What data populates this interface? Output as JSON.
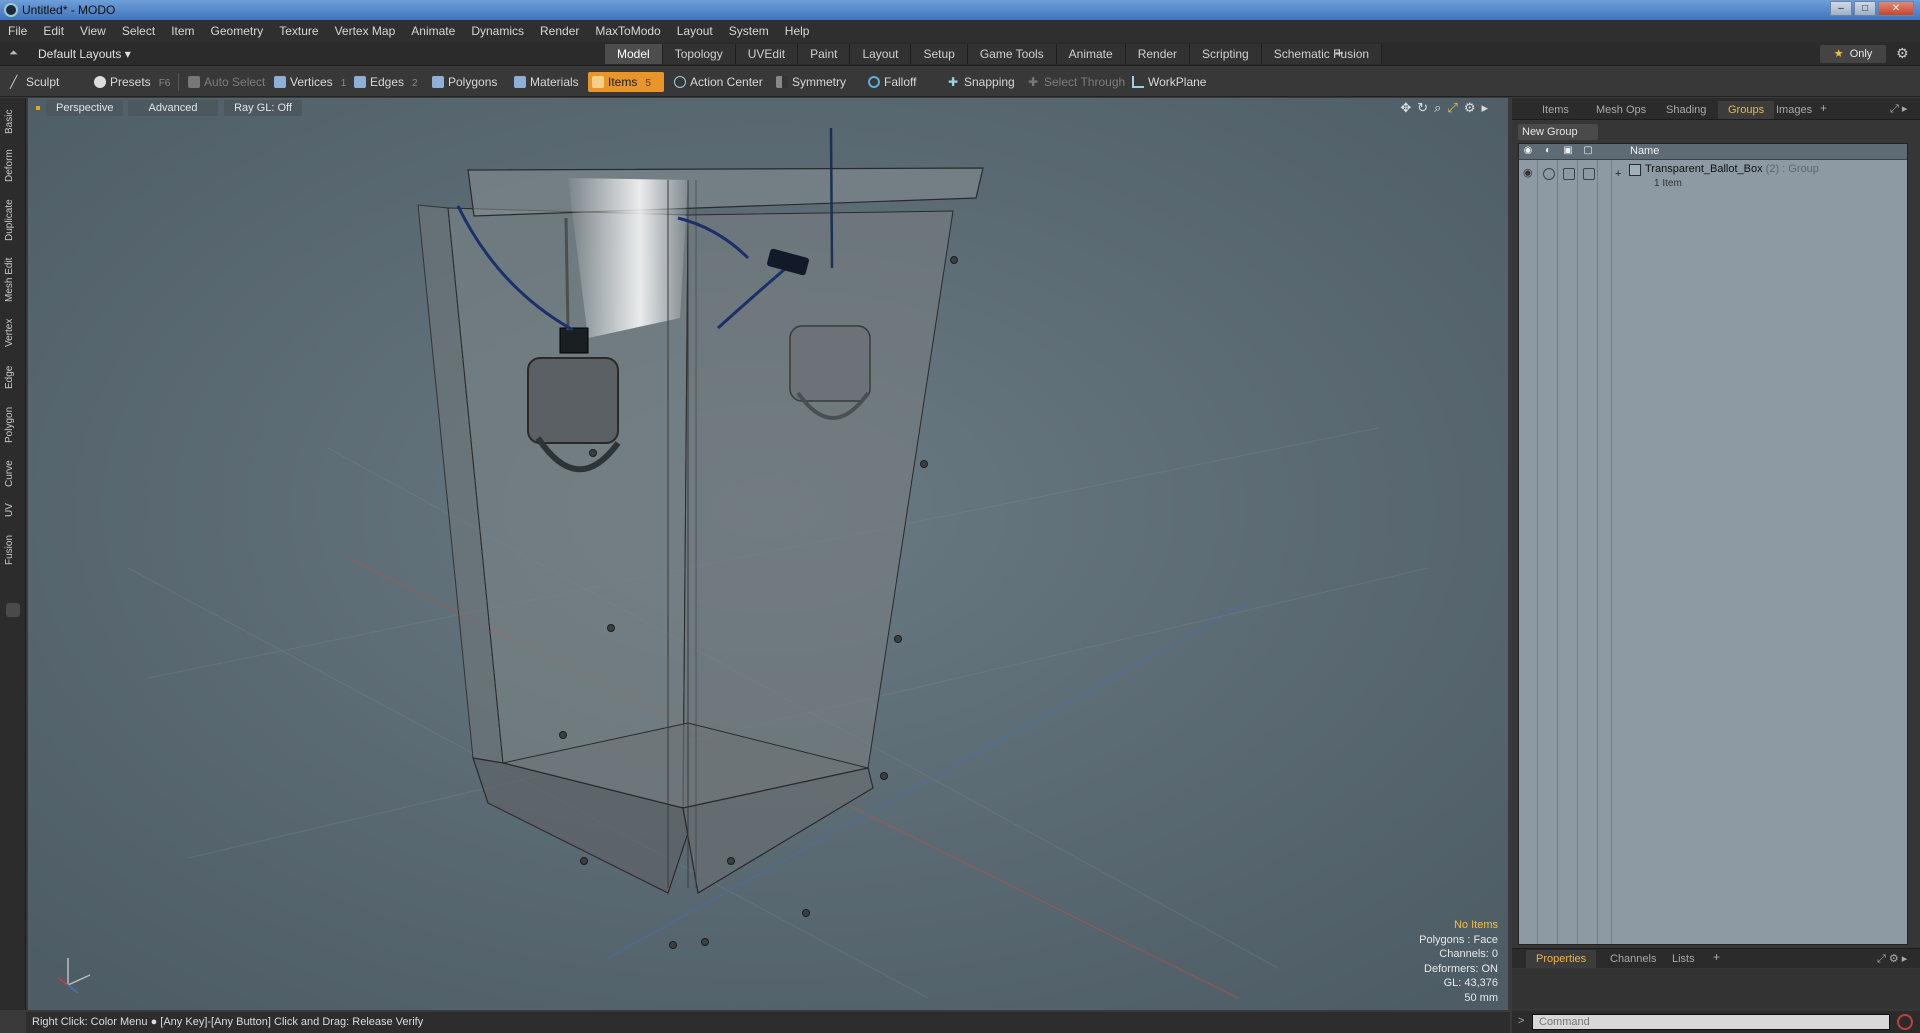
{
  "window": {
    "title": "Untitled* - MODO",
    "controls": {
      "minimize": "–",
      "maximize": "□",
      "close": "✕"
    }
  },
  "menubar": [
    "File",
    "Edit",
    "View",
    "Select",
    "Item",
    "Geometry",
    "Texture",
    "Vertex Map",
    "Animate",
    "Dynamics",
    "Render",
    "MaxToModo",
    "Layout",
    "System",
    "Help"
  ],
  "layouts": {
    "label": "Default Layouts ▾"
  },
  "tabs": [
    "Model",
    "Topology",
    "UVEdit",
    "Paint",
    "Layout",
    "Setup",
    "Game Tools",
    "Animate",
    "Render",
    "Scripting",
    "Schematic Fusion"
  ],
  "active_tab": "Model",
  "tab_add": "+",
  "only_button": {
    "star": "★",
    "label": "Only"
  },
  "toolbar": {
    "sculpt": "Sculpt",
    "presets": "Presets",
    "presets_key": "F6",
    "auto_select": "Auto Select",
    "vertices": "Vertices",
    "vertices_key": "1",
    "edges": "Edges",
    "edges_key": "2",
    "polygons": "Polygons",
    "materials": "Materials",
    "items": "Items",
    "items_key": "5",
    "action_center": "Action Center",
    "symmetry": "Symmetry",
    "falloff": "Falloff",
    "snapping": "Snapping",
    "select_through": "Select Through",
    "workplane": "WorkPlane"
  },
  "left_tabs": [
    "Basic",
    "Deform",
    "Duplicate",
    "Mesh Edit",
    "Vertex",
    "Edge",
    "Polygon",
    "Curve",
    "UV",
    "Fusion"
  ],
  "viewport": {
    "view": "Perspective",
    "mode": "Advanced",
    "raygl": "Ray GL: Off",
    "hud": {
      "items": "No Items",
      "polygons": "Polygons : Face",
      "channels": "Channels: 0",
      "deformers": "Deformers: ON",
      "gl": "GL: 43,376",
      "scale": "50 mm"
    }
  },
  "status": "Right Click: Color Menu ● [Any Key]-[Any Button] Click and Drag: Release Verify",
  "right_panel": {
    "tabs": [
      "Items",
      "Mesh Ops",
      "Shading",
      "Groups",
      "Images"
    ],
    "active_tab": "Groups",
    "tab_add": "+",
    "new_group": "New Group",
    "column_name": "Name",
    "group": {
      "name": "Transparent_Ballot_Box",
      "suffix": "(2) : Group",
      "count": "1 Item"
    },
    "bottom_tabs": [
      "Properties",
      "Channels",
      "Lists"
    ],
    "bottom_active": "Properties",
    "command_placeholder": "Command"
  },
  "colors": {
    "accent": "#f2b440",
    "active_tool": "#e8962a",
    "viewport_bg": "#5a6a72",
    "titlebar": "#3f73bd"
  }
}
